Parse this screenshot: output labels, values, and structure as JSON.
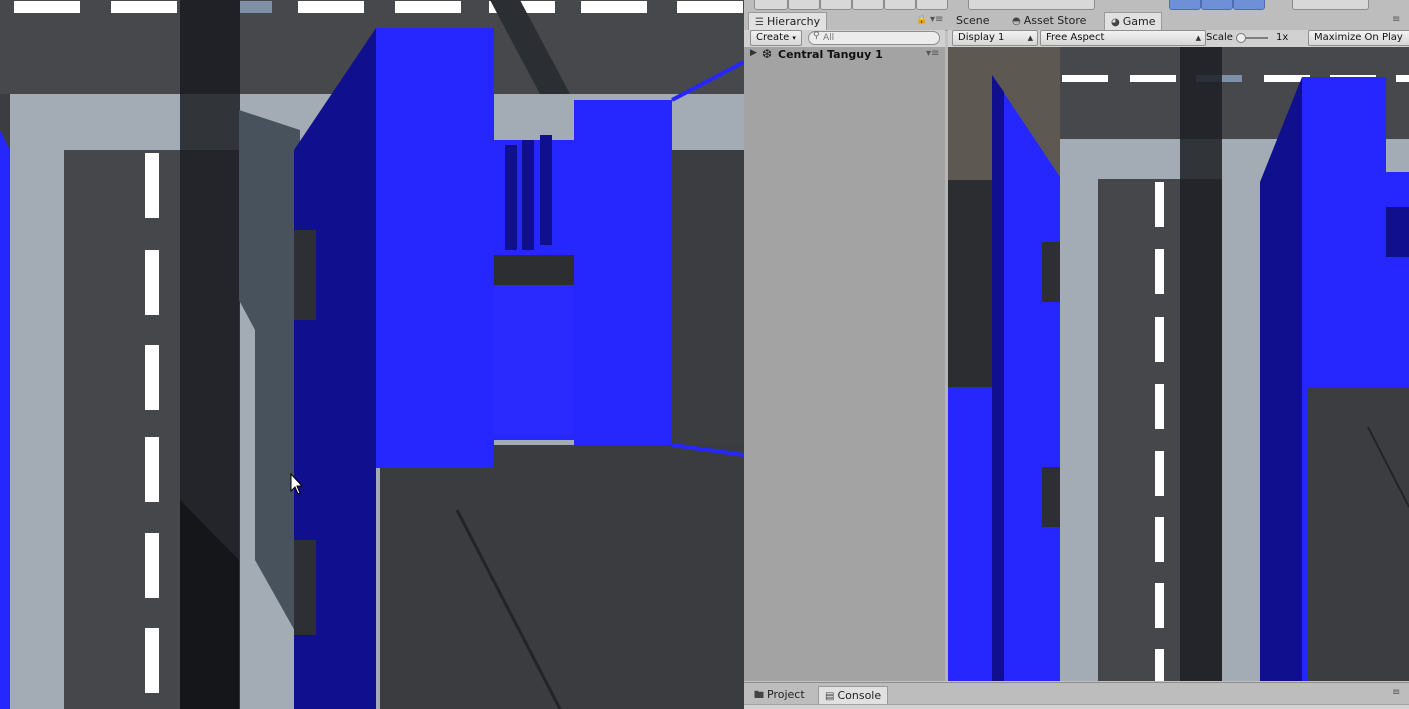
{
  "hierarchy": {
    "tab_label": "Hierarchy",
    "create_label": "Create",
    "search_placeholder": "All",
    "root_item": "Central Tanguy 1"
  },
  "center_tabs": {
    "scene": "Scene",
    "asset_store": "Asset Store",
    "game": "Game"
  },
  "game_toolbar": {
    "display": "Display 1",
    "aspect": "Free Aspect",
    "scale_label": "Scale",
    "scale_value": "1x",
    "maximize": "Maximize On Play"
  },
  "bottom_tabs": {
    "project": "Project",
    "console": "Console"
  },
  "icons": {
    "hierarchy": "list-icon",
    "unity_object": "unity-logo-icon",
    "game": "pacman-icon",
    "asset_store": "store-bag-icon",
    "project": "folder-icon",
    "console": "console-icon",
    "lock": "lock-icon",
    "menu": "panel-menu-icon"
  },
  "colors": {
    "building_blue": "#2626ff",
    "building_shade": "#10108f",
    "road": "#3b3d40",
    "sidewalk": "#a3acb4",
    "shadow": "#1a1d20"
  }
}
